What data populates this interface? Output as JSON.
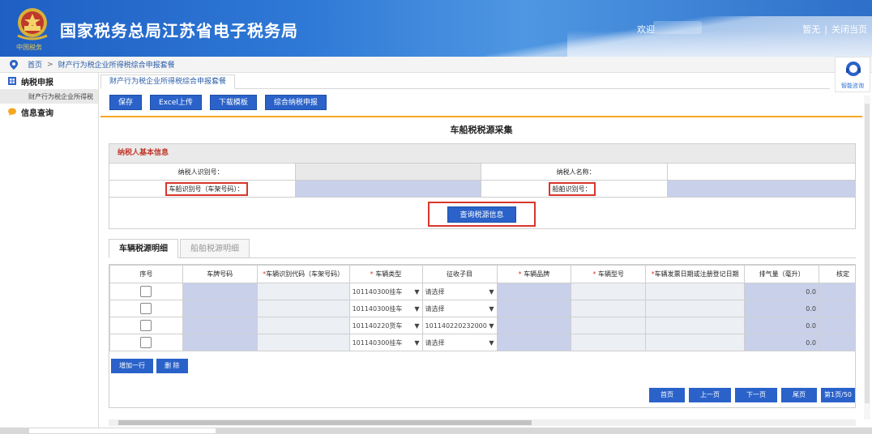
{
  "header": {
    "site_title": "国家税务总局江苏省电子税务局",
    "logo_text": "中国税务",
    "welcome": "欢迎",
    "link_none": "暂无",
    "link_close": "关闭当页",
    "separator": "|"
  },
  "breadcrumb": {
    "home": "首页",
    "separator": ">",
    "current": "财产行为税企业所得税综合申报套餐"
  },
  "sidebar": {
    "items": [
      {
        "label": "纳税申报",
        "icon": "grid-icon"
      },
      {
        "sub_label": "财产行为税企业所得税"
      },
      {
        "label": "信息查询",
        "icon": "chat-bubble-icon"
      }
    ]
  },
  "help": {
    "label": "智能咨询"
  },
  "tab": {
    "label": "财产行为税企业所得税综合申报套餐"
  },
  "toolbar": {
    "save": "保存",
    "excel_upload": "Excel上传",
    "download_template": "下载模板",
    "comprehensive_report": "综合纳税申报"
  },
  "form": {
    "title": "车船税税源采集",
    "panel_title": "纳税人基本信息",
    "taxpayer_id_label": "纳税人识别号：",
    "taxpayer_name_label": "纳税人名称：",
    "vehicle_id_label": "车船识别号（车架号码）：",
    "ship_id_label": "船舶识别号：",
    "query_button": "查询税源信息"
  },
  "detail_tabs": {
    "vehicle": "车辆税源明细",
    "ship": "船舶税源明细"
  },
  "grid": {
    "columns": {
      "seq": "序号",
      "plate": "车牌号码",
      "vin": "车辆识别代码（车架号码）",
      "vtype": "车辆类型",
      "sub_item": "征收子目",
      "brand": "车辆品牌",
      "model": "车辆型号",
      "reg_date": "车辆发票日期或注册登记日期",
      "displacement": "排气量（毫升）",
      "verified": "核定"
    },
    "required_mark": "*",
    "rows": [
      {
        "vtype": "101140300挂车",
        "sub_item": "请选择",
        "displacement": "0.0"
      },
      {
        "vtype": "101140300挂车",
        "sub_item": "请选择",
        "displacement": "0.0"
      },
      {
        "vtype": "101140220货车",
        "sub_item": "101140220232000",
        "displacement": "0.0"
      },
      {
        "vtype": "101140300挂车",
        "sub_item": "请选择",
        "displacement": "0.0"
      }
    ],
    "dropdown_arrow": "▼",
    "add_row": "增加一行",
    "delete": "删 除"
  },
  "pager": {
    "first": "首页",
    "prev": "上一页",
    "next": "下一页",
    "last": "尾页",
    "info": "第1页/50"
  },
  "colors": {
    "primary_button": "#2a62c9",
    "highlight_red": "#d9362b",
    "accent_orange": "#f5a623",
    "input_blue": "#c8d0ea"
  }
}
